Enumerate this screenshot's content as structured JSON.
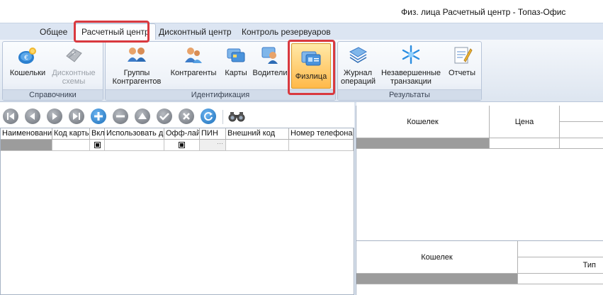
{
  "window": {
    "title": "Физ. лица Расчетный центр - Топаз-Офис"
  },
  "tabs": [
    {
      "label": "Общее"
    },
    {
      "label": "Расчетный центр"
    },
    {
      "label": "Дисконтный центр"
    },
    {
      "label": "Контроль резервуаров"
    }
  ],
  "ribbon": {
    "groups": [
      {
        "label": "Справочники",
        "buttons": [
          {
            "label": "Кошельки",
            "icon": "wallets-icon"
          },
          {
            "label": "Дисконтные схемы",
            "icon": "discount-schemes-icon",
            "disabled": true
          }
        ]
      },
      {
        "label": "Идентификация",
        "buttons": [
          {
            "label": "Группы Контрагентов",
            "icon": "contractor-groups-icon"
          },
          {
            "label": "Контрагенты",
            "icon": "contractors-icon"
          },
          {
            "label": "Карты",
            "icon": "cards-icon"
          },
          {
            "label": "Водители",
            "icon": "drivers-icon"
          },
          {
            "label": "Физлица",
            "icon": "individuals-icon",
            "selected": true
          }
        ]
      },
      {
        "label": "Результаты",
        "buttons": [
          {
            "label": "Журнал операций",
            "icon": "journal-icon"
          },
          {
            "label": "Незавершенные транзакции",
            "icon": "pending-transactions-icon"
          },
          {
            "label": "Отчеты",
            "icon": "reports-icon"
          }
        ]
      }
    ]
  },
  "toolbar": {
    "icons": [
      "first-record-icon",
      "previous-record-icon",
      "next-record-icon",
      "last-record-icon",
      "add-icon",
      "remove-icon",
      "move-up-icon",
      "confirm-icon",
      "cancel-icon",
      "refresh-icon",
      "find-icon"
    ]
  },
  "left_grid": {
    "columns": [
      "Наименовани",
      "Код карты",
      "Вкл",
      "Использовать д",
      "Офф-лай",
      "ПИН",
      "Внешний код",
      "Номер телефона"
    ],
    "row": {
      "dots": "···"
    }
  },
  "right_top_grid": {
    "columns": [
      "Кошелек",
      "Цена"
    ]
  },
  "right_bottom_grid": {
    "columns": [
      "Кошелек",
      "Тип"
    ]
  },
  "colors": {
    "highlight": "#d9393f",
    "selected_button": "#ffb94a",
    "ribbon_bg": "#dde5f0"
  }
}
